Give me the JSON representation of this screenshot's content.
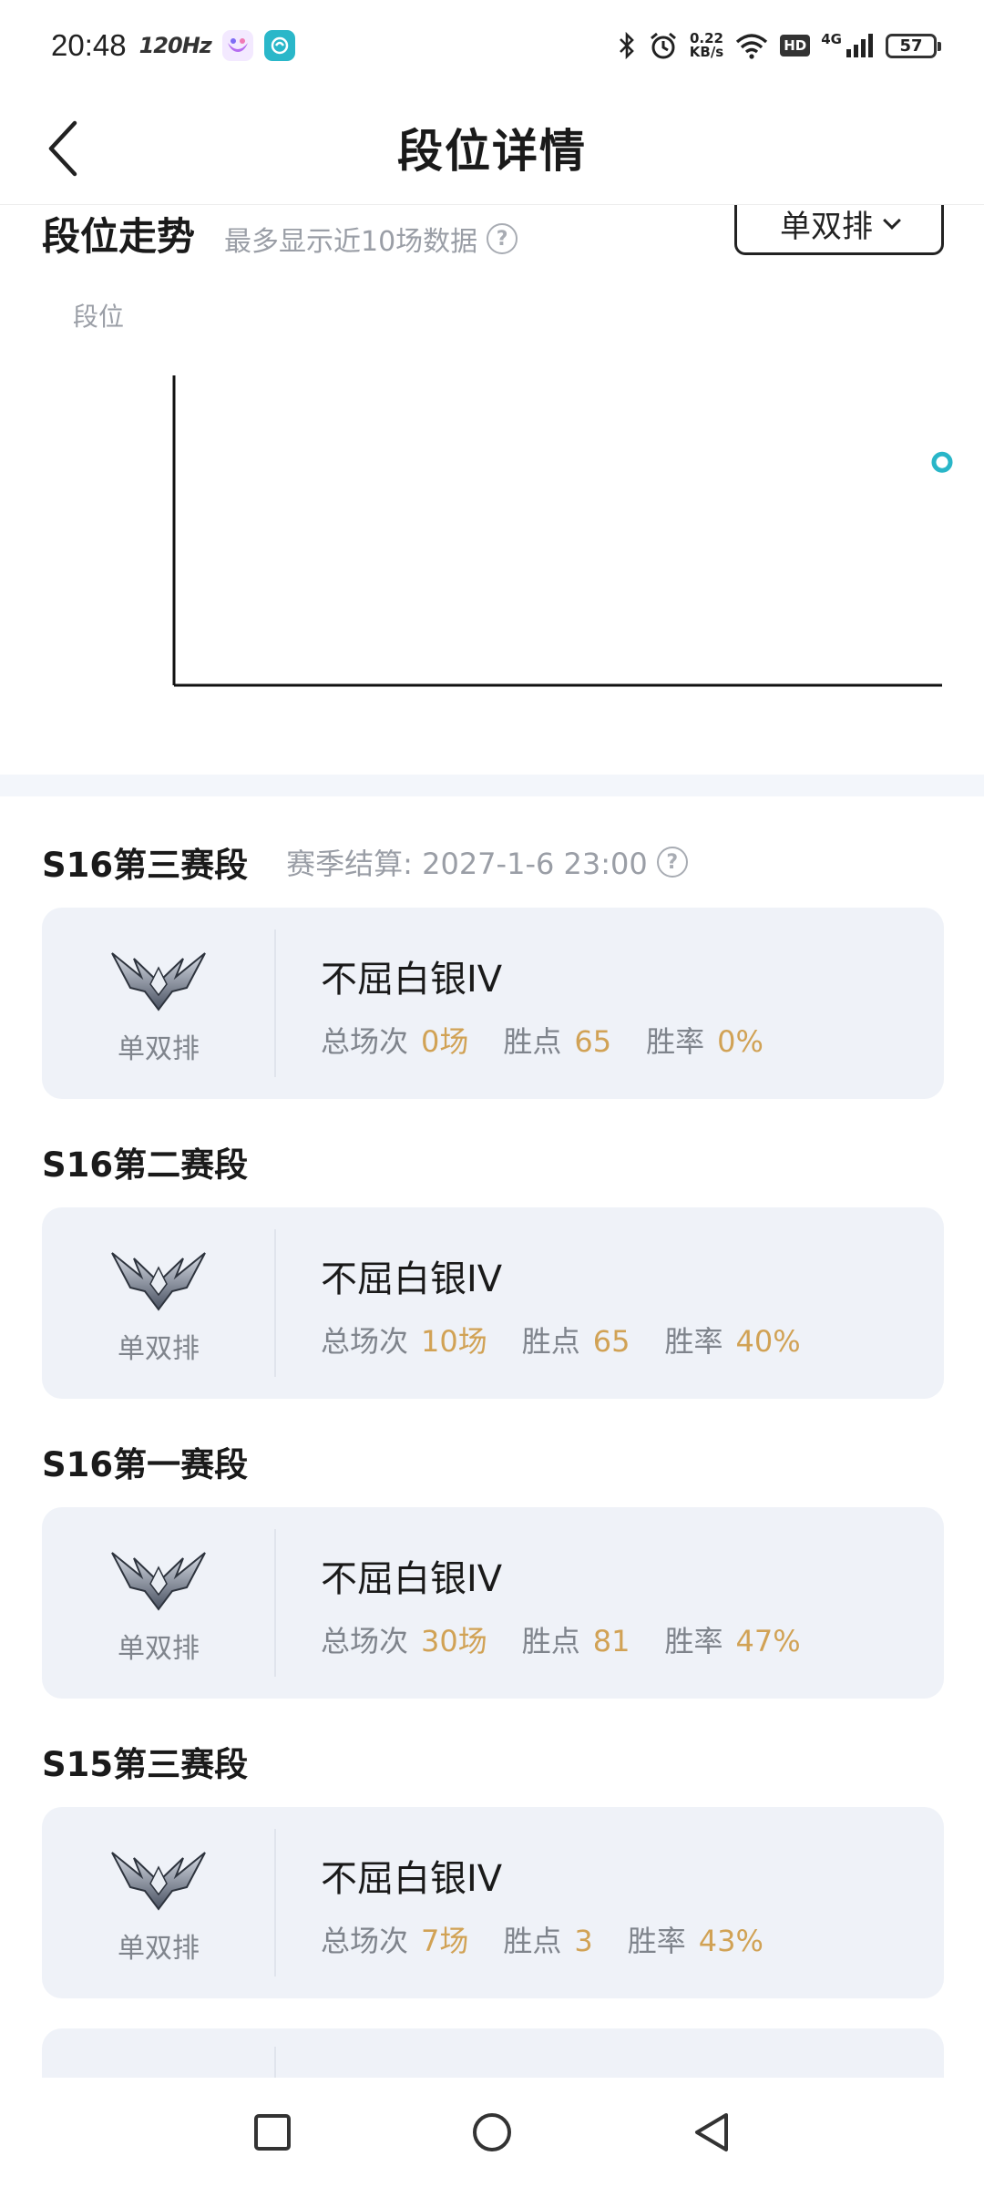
{
  "status_bar": {
    "time": "20:48",
    "refresh_rate": "120Hz",
    "net_speed_value": "0.22",
    "net_speed_unit": "KB/s",
    "hd": "HD",
    "signal": "4G",
    "battery": "57"
  },
  "header": {
    "title": "段位详情"
  },
  "trend": {
    "title": "段位走势",
    "subtitle": "最多显示近10场数据",
    "mode_label": "单双排",
    "y_axis_label": "段位"
  },
  "chart_data": {
    "type": "line",
    "ylabel": "段位",
    "points": [
      {
        "x": 1,
        "y": 1
      }
    ],
    "grid": false,
    "marker_color": "#29b6c8"
  },
  "seasons": [
    {
      "title": "S16第三赛段",
      "settle_label": "赛季结算: 2027-1-6 23:00",
      "queue": "单双排",
      "rank": "不屈白银IV",
      "games_label": "总场次",
      "games": "0场",
      "points_label": "胜点",
      "points": "65",
      "winrate_label": "胜率",
      "winrate": "0%"
    },
    {
      "title": "S16第二赛段",
      "queue": "单双排",
      "rank": "不屈白银IV",
      "games_label": "总场次",
      "games": "10场",
      "points_label": "胜点",
      "points": "65",
      "winrate_label": "胜率",
      "winrate": "40%"
    },
    {
      "title": "S16第一赛段",
      "queue": "单双排",
      "rank": "不屈白银IV",
      "games_label": "总场次",
      "games": "30场",
      "points_label": "胜点",
      "points": "81",
      "winrate_label": "胜率",
      "winrate": "47%"
    },
    {
      "title": "S15第三赛段",
      "queue": "单双排",
      "rank": "不屈白银IV",
      "games_label": "总场次",
      "games": "7场",
      "points_label": "胜点",
      "points": "3",
      "winrate_label": "胜率",
      "winrate": "43%"
    }
  ],
  "colors": {
    "accent_value": "#d1a255",
    "card_bg": "#eff2f8",
    "muted_text": "#9a9ea6"
  },
  "icons": {
    "back": "chevron-left-icon",
    "help": "help-circle-icon",
    "rank_badge": "silver-rank-badge-icon",
    "nav_recent": "square-icon",
    "nav_home": "circle-icon",
    "nav_back": "triangle-back-icon"
  }
}
